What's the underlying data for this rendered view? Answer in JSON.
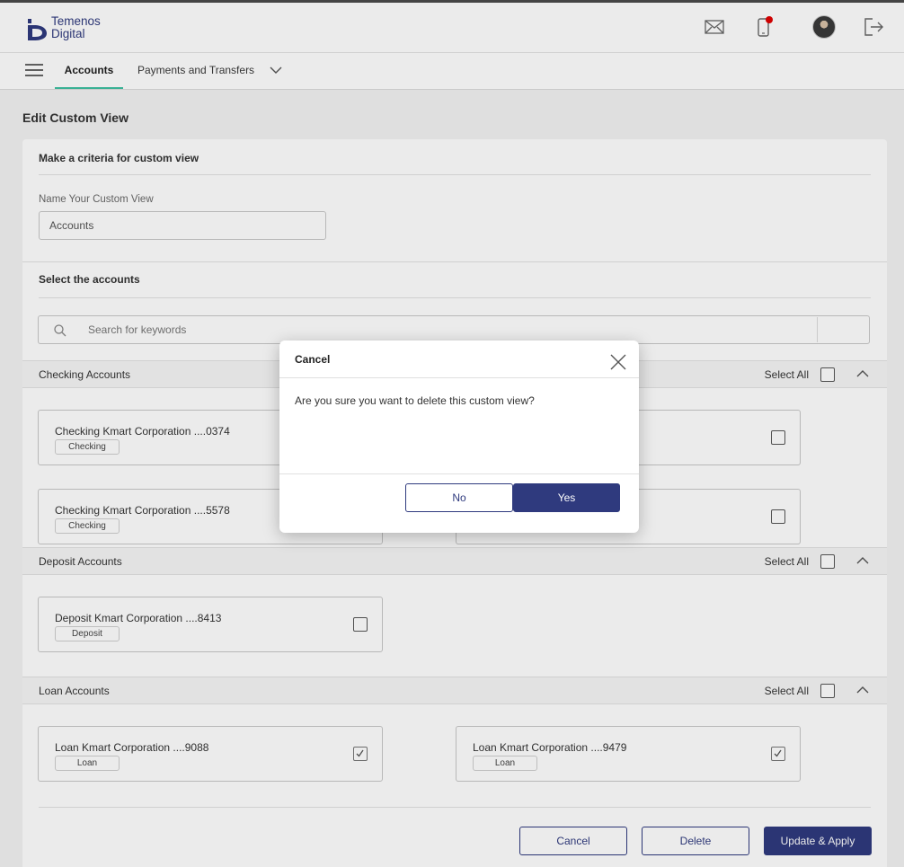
{
  "brand": {
    "line1": "Temenos",
    "line2": "Digital",
    "color": "#2f3a7e"
  },
  "header_icons": [
    "mail-icon",
    "mobile-notification-icon",
    "avatar",
    "logout-icon"
  ],
  "nav": {
    "tabs": [
      {
        "label": "Accounts",
        "active": true
      },
      {
        "label": "Payments and Transfers",
        "active": false
      }
    ]
  },
  "page": {
    "title": "Edit Custom View",
    "criteria_heading": "Make a criteria for custom view",
    "name_label": "Name Your Custom View",
    "name_value": "Accounts",
    "select_heading": "Select the accounts",
    "search_placeholder": "Search for keywords"
  },
  "groups": {
    "checking": {
      "title": "Checking Accounts",
      "select_all": "Select All",
      "accounts": [
        {
          "name": "Checking Kmart Corporation ....0374",
          "tag": "Checking",
          "checked": false
        },
        {
          "name": "Checking Kmart Corporation ....5578",
          "tag": "Checking",
          "checked": false
        }
      ]
    },
    "deposit": {
      "title": "Deposit Accounts",
      "select_all": "Select All",
      "accounts": [
        {
          "name": "Deposit Kmart Corporation ....8413",
          "tag": "Deposit",
          "checked": false
        }
      ]
    },
    "loan": {
      "title": "Loan Accounts",
      "select_all": "Select All",
      "accounts": [
        {
          "name": "Loan Kmart Corporation ....9088",
          "tag": "Loan",
          "checked": true
        },
        {
          "name": "Loan Kmart Corporation ....9479",
          "tag": "Loan",
          "checked": true
        }
      ]
    }
  },
  "footer": {
    "cancel": "Cancel",
    "delete": "Delete",
    "update": "Update & Apply"
  },
  "modal": {
    "title": "Cancel",
    "question": "Are you sure you want to delete this custom view?",
    "no": "No",
    "yes": "Yes"
  },
  "colors": {
    "primary": "#2f3a7e",
    "active_tab_underline": "#3ec0a2",
    "notification_dot": "#e00000"
  }
}
